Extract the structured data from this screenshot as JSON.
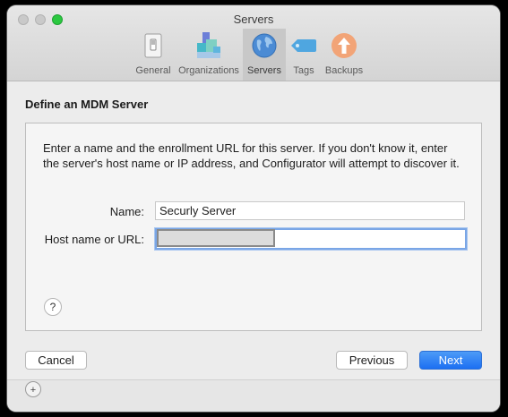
{
  "window": {
    "title": "Servers"
  },
  "toolbar": {
    "tabs": [
      {
        "label": "General",
        "icon": "switch-icon"
      },
      {
        "label": "Organizations",
        "icon": "organization-blocks-icon"
      },
      {
        "label": "Servers",
        "icon": "globe-icon",
        "selected": true
      },
      {
        "label": "Tags",
        "icon": "tag-icon"
      },
      {
        "label": "Backups",
        "icon": "backup-arrow-icon"
      }
    ]
  },
  "sheet": {
    "title": "Define an MDM Server",
    "intro": "Enter a name and the enrollment URL for this server. If you don't know it, enter the server's host name or IP address, and Configurator will attempt to discover it.",
    "name_label": "Name:",
    "name_value": "Securly Server",
    "host_label": "Host name or URL:",
    "host_value": "",
    "help_label": "?",
    "cancel_label": "Cancel",
    "previous_label": "Previous",
    "next_label": "Next"
  },
  "background": {
    "partial_button_label": "+"
  },
  "colors": {
    "accent": "#1c6ff2",
    "zoom_button": "#2bc840",
    "focus_ring": "#7aa6e6"
  }
}
